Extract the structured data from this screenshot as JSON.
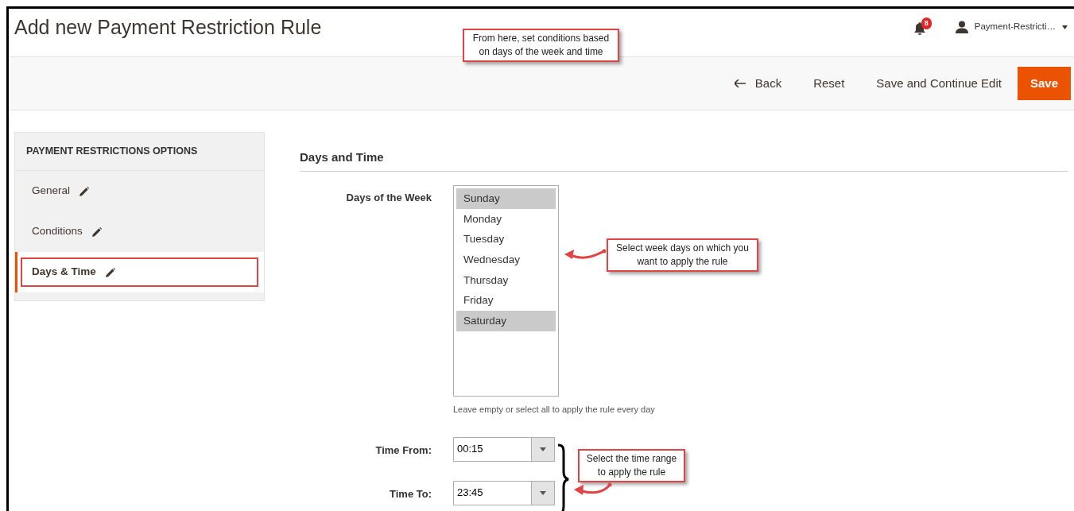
{
  "header": {
    "title": "Add new Payment Restriction Rule",
    "notifications_count": "8",
    "user": "Payment-Restricti…"
  },
  "toolbar": {
    "buttons": [
      {
        "label": "Back",
        "kind": "back"
      },
      {
        "label": "Reset",
        "kind": "plain"
      },
      {
        "label": "Save and Continue Edit",
        "kind": "plain"
      },
      {
        "label": "Save",
        "kind": "primary"
      }
    ]
  },
  "sidebar": {
    "title": "PAYMENT RESTRICTIONS OPTIONS",
    "items": [
      {
        "label": "General",
        "selected": false,
        "highlighted": false
      },
      {
        "label": "Conditions",
        "selected": false,
        "highlighted": false
      },
      {
        "label": "Days & Time",
        "selected": true,
        "highlighted": true
      }
    ]
  },
  "section": {
    "title": "Days and Time",
    "days_field": {
      "label": "Days of the Week",
      "options": [
        {
          "label": "Sunday",
          "selected": true
        },
        {
          "label": "Monday",
          "selected": false
        },
        {
          "label": "Tuesday",
          "selected": false
        },
        {
          "label": "Wednesday",
          "selected": false
        },
        {
          "label": "Thursday",
          "selected": false
        },
        {
          "label": "Friday",
          "selected": false
        },
        {
          "label": "Saturday",
          "selected": true
        }
      ],
      "note": "Leave empty or select all to apply the rule every day"
    },
    "time_fields": [
      {
        "label": "Time From:",
        "value": "00:15"
      },
      {
        "label": "Time To:",
        "value": "23:45"
      }
    ]
  },
  "callouts": [
    {
      "kind": "top",
      "text": "From here, set conditions based on days of the week and time"
    },
    {
      "kind": "days",
      "text": "Select week days on which you want to apply the rule"
    },
    {
      "kind": "time",
      "text": "Select the time range to apply the rule"
    }
  ]
}
